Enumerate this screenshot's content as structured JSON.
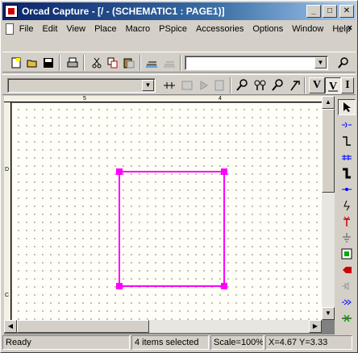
{
  "window": {
    "title": "Orcad Capture - [/ - (SCHEMATIC1 : PAGE1)]",
    "minimize_label": "_",
    "maximize_label": "□",
    "close_label": "✕"
  },
  "menu": {
    "items": [
      "File",
      "Edit",
      "View",
      "Place",
      "Macro",
      "PSpice",
      "Accessories",
      "Options",
      "Window",
      "Help"
    ],
    "doc_minimize": "_",
    "doc_close": "×"
  },
  "toolbar1": {
    "part_combo_value": ""
  },
  "toolbar2": {
    "net_combo_value": "",
    "v_label": "V",
    "i_label": "I"
  },
  "rulers": {
    "top_labels": [
      "5",
      "4"
    ],
    "left_labels": [
      "D",
      "C"
    ]
  },
  "palette": {
    "items": [
      "select-tool-icon",
      "place-part-icon",
      "wire-icon",
      "bus-icon",
      "bus-entry-icon",
      "junction-icon",
      "net-alias-icon",
      "power-icon",
      "ground-icon",
      "hierarchical-block-icon",
      "hierarchical-port-icon",
      "hierarchical-pin-icon",
      "off-page-connector-icon",
      "no-connect-icon"
    ]
  },
  "status": {
    "ready": "Ready",
    "selected": "4 items selected",
    "scale": "Scale=100%",
    "coords": "X=4.67  Y=3.33"
  },
  "colors": {
    "selection": "#ff00ff",
    "title_bar_start": "#0a246a",
    "title_bar_end": "#a6caf0",
    "canvas": "#fffff8"
  }
}
